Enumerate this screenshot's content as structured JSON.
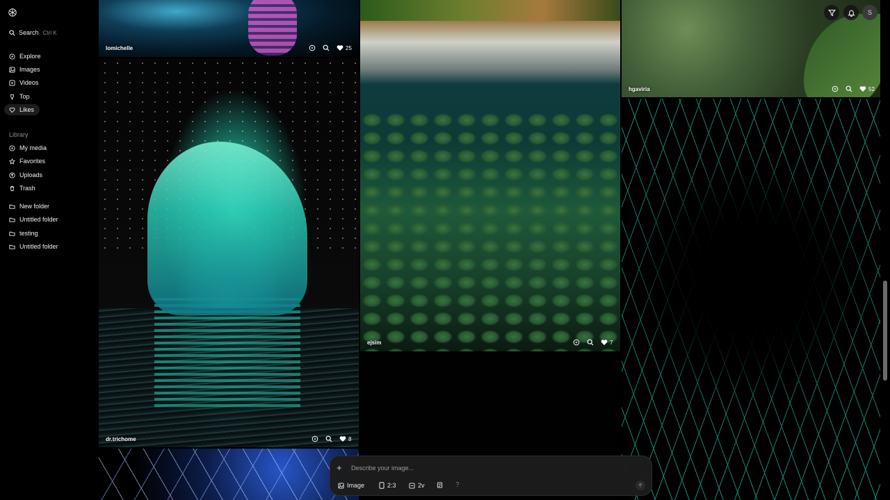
{
  "sidebar": {
    "search_label": "Search",
    "search_shortcut": "Ctrl K",
    "nav": [
      {
        "label": "Explore",
        "icon": "compass-icon"
      },
      {
        "label": "Images",
        "icon": "image-icon"
      },
      {
        "label": "Videos",
        "icon": "video-icon"
      },
      {
        "label": "Top",
        "icon": "trophy-icon"
      },
      {
        "label": "Likes",
        "icon": "heart-icon",
        "active": true
      }
    ],
    "library_label": "Library",
    "library": [
      {
        "label": "My media",
        "icon": "media-icon"
      },
      {
        "label": "Favorites",
        "icon": "star-icon"
      },
      {
        "label": "Uploads",
        "icon": "upload-icon"
      },
      {
        "label": "Trash",
        "icon": "trash-icon"
      }
    ],
    "folders": [
      {
        "label": "New folder"
      },
      {
        "label": "Untitled folder"
      },
      {
        "label": "testing"
      },
      {
        "label": "Untitled folder"
      }
    ]
  },
  "feed": {
    "tiles": [
      {
        "user": "lomichelle",
        "likes": "25"
      },
      {
        "user": "dr.trichome",
        "likes": "8"
      },
      {
        "user": "ejsim",
        "likes": "7"
      },
      {
        "user": "hgaviria",
        "likes": "52"
      }
    ]
  },
  "header": {
    "avatar_initial": "S"
  },
  "composer": {
    "placeholder": "Describe your image...",
    "mode_label": "Image",
    "aspect_label": "2:3",
    "variations_label": "2v",
    "help": "?"
  },
  "colors": {
    "background": "#000000",
    "accent_teal": "#2fe0c2",
    "sidebar_active": "#1d1d1d"
  }
}
